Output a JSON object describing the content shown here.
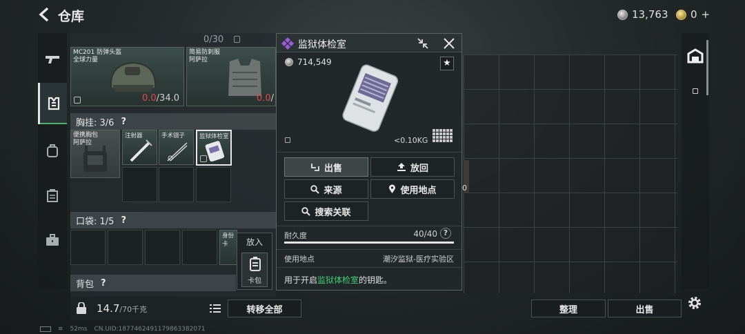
{
  "header": {
    "title": "仓库"
  },
  "currency": {
    "silver": "13,763",
    "gold": "0",
    "gold_plus": "+"
  },
  "sidebar": {
    "items": [
      "gun-icon",
      "armor-icon",
      "backpack-icon",
      "box-icon",
      "briefcase-icon"
    ]
  },
  "gear": {
    "capacity": "0/30",
    "helmet": {
      "name_line1": "MC201 防弹头盔",
      "name_line2": "全球力量",
      "dur_current": "0.0",
      "dur_max": "/34.0"
    },
    "armor": {
      "name_line1": "简易防刺服",
      "name_line2": "阿萨拉",
      "dur_current": "0.0",
      "dur_max": "/"
    }
  },
  "chest": {
    "header": "胸挂: 3/6",
    "help": "?",
    "rig": {
      "name_line1": "便携胸包",
      "name_line2": "阿萨拉"
    },
    "items": [
      "注射器",
      "手术镊子",
      "监狱体检室"
    ]
  },
  "pocket": {
    "header": "口袋: 1/5",
    "help": "?",
    "item": "身份卡"
  },
  "backpack": {
    "header": "背包",
    "help": "?"
  },
  "weight": {
    "current": "14.7",
    "max": "/70千克"
  },
  "buttons": {
    "transfer_all": "转移全部",
    "organize": "整理",
    "sell": "出售"
  },
  "context_menu": {
    "put": "放入",
    "card_pack": "卡包"
  },
  "detail": {
    "title": "监狱体检室",
    "price": "714,549",
    "weight": "<0.10KG",
    "actions": {
      "sell": "出售",
      "return": "放回",
      "source": "来源",
      "use_location": "使用地点",
      "search_related": "搜索关联"
    },
    "durability_label": "耐久度",
    "durability_value": "40/40",
    "durability_fraction": 1.0,
    "help": "?",
    "location_label": "使用地点",
    "location_value": "潮汐监狱-医疗实验区",
    "desc_prefix": "用于开启",
    "desc_highlight": "监狱体检室",
    "desc_suffix": "的钥匙。"
  },
  "grid_edge_value": "0",
  "status_bar": {
    "latency": "52ms",
    "uid": "CN.UID:1877462491179863382071"
  },
  "colors": {
    "accent_green": "#3fd173",
    "danger_red": "#e04b4b",
    "key_purple": "#9b5bdc"
  }
}
